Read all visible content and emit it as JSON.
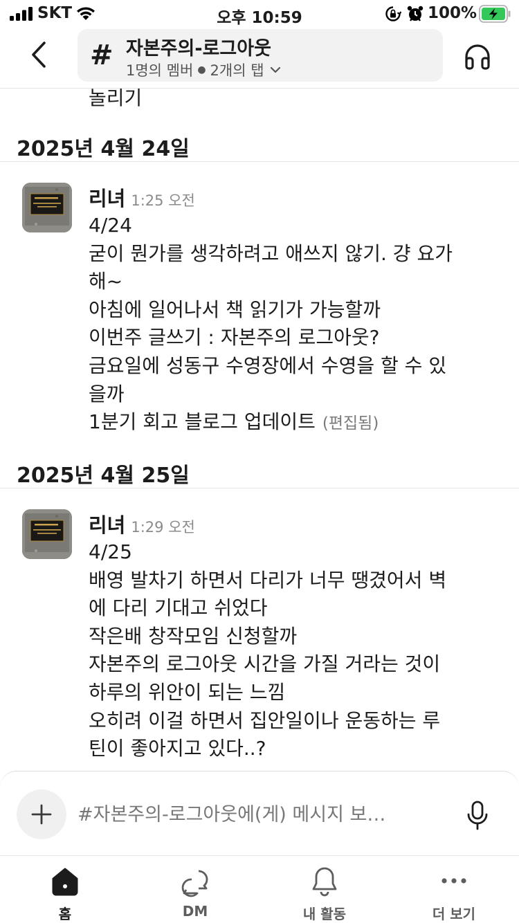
{
  "status_bar": {
    "carrier": "SKT",
    "time": "오후 10:59",
    "battery": "100%",
    "battery_color": "#34c759"
  },
  "header": {
    "back_icon": "chevron-left-icon",
    "hash_symbol": "#",
    "channel_name": "자본주의-로그아웃",
    "members": "1명의 멤버",
    "tabs": "2개의 탭",
    "huddle_icon": "headphones-icon"
  },
  "messages": {
    "prev_tail": "놀리기",
    "groups": [
      {
        "date": "2025년 4월 24일",
        "author": "리녀",
        "time": "1:25 오전",
        "lines": [
          "4/24",
          "굳이 뭔가를 생각하려고 애쓰지 않기. 걍 요가",
          "해~",
          "아침에 일어나서 책 읽기가 가능할까",
          "이번주 글쓰기 : 자본주의 로그아웃?",
          "금요일에 성동구 수영장에서 수영을 할 수 있",
          "을까",
          "1분기 회고 블로그 업데이트"
        ],
        "edited": "(편집됨)"
      },
      {
        "date": "2025년 4월 25일",
        "author": "리녀",
        "time": "1:29 오전",
        "lines": [
          "4/25",
          "배영 발차기 하면서 다리가 너무 땡겼어서 벽",
          "에 다리 기대고 쉬었다",
          "작은배 창작모임 신청할까",
          "자본주의 로그아웃 시간을 가질 거라는 것이",
          "하루의 위안이 되는 느낌",
          "오히려 이걸 하면서 집안일이나 운동하는 루",
          "틴이 좋아지고 있다..?"
        ]
      }
    ]
  },
  "composer": {
    "placeholder": "#자본주의-로그아웃에(게) 메시지 보…",
    "attach_icon": "plus-icon",
    "mic_icon": "microphone-icon"
  },
  "tabs": [
    {
      "label": "홈",
      "icon": "home-icon",
      "active": true
    },
    {
      "label": "DM",
      "icon": "dm-icon",
      "active": false
    },
    {
      "label": "내 활동",
      "icon": "bell-icon",
      "active": false
    },
    {
      "label": "더 보기",
      "icon": "more-icon",
      "active": false
    }
  ]
}
